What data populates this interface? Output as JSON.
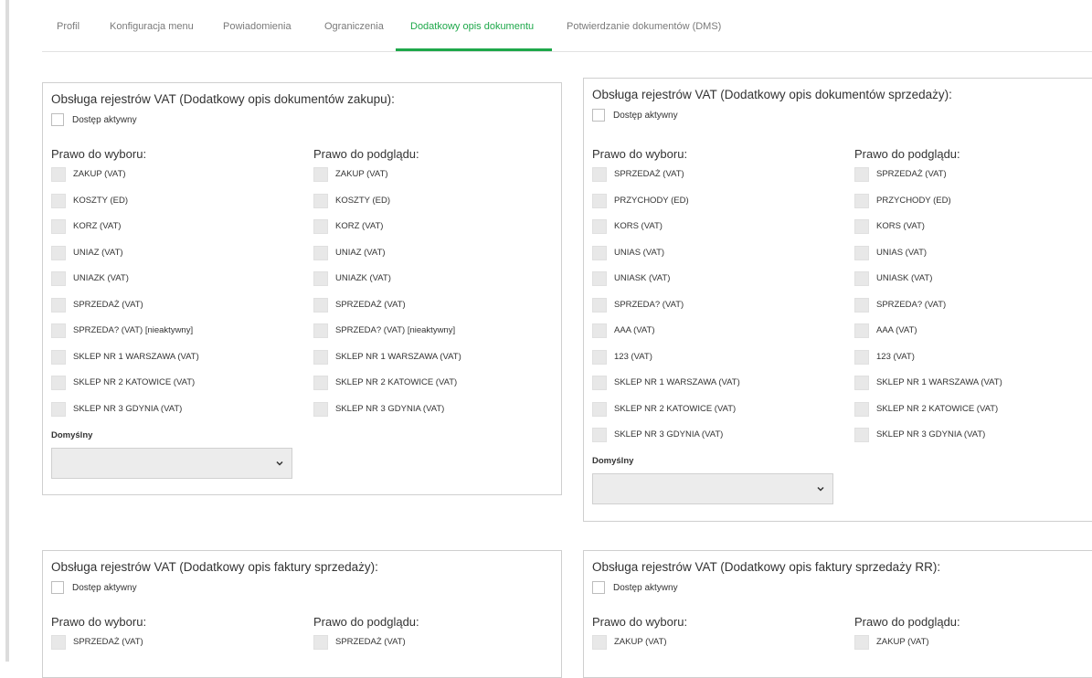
{
  "tabs": [
    {
      "label": "Profil"
    },
    {
      "label": "Konfiguracja menu"
    },
    {
      "label": "Powiadomienia"
    },
    {
      "label": "Ograniczenia"
    },
    {
      "label": "Dodatkowy opis dokumentu"
    },
    {
      "label": "Potwierdzanie dokumentów (DMS)"
    }
  ],
  "active_tab": "Dodatkowy opis dokumentu",
  "colors": {
    "accent": "#1ea84a"
  },
  "labels": {
    "access": "Dostęp aktywny",
    "choose": "Prawo do wyboru:",
    "preview": "Prawo do podglądu:",
    "default": "Domyślny"
  },
  "panels": [
    {
      "title": "Obsługa rejestrów VAT (Dodatkowy opis dokumentów zakupu):",
      "access_checked": false,
      "choose_items": [
        "ZAKUP (VAT)",
        "KOSZTY (ED)",
        "KORZ (VAT)",
        "UNIAZ (VAT)",
        "UNIAZK (VAT)",
        "SPRZEDAŻ (VAT)",
        "SPRZEDA? (VAT) [nieaktywny]",
        "SKLEP NR 1 WARSZAWA (VAT)",
        "SKLEP NR 2 KATOWICE (VAT)",
        "SKLEP NR 3 GDYNIA (VAT)"
      ],
      "preview_items": [
        "ZAKUP (VAT)",
        "KOSZTY (ED)",
        "KORZ (VAT)",
        "UNIAZ (VAT)",
        "UNIAZK (VAT)",
        "SPRZEDAŻ (VAT)",
        "SPRZEDA? (VAT) [nieaktywny]",
        "SKLEP NR 1 WARSZAWA (VAT)",
        "SKLEP NR 2 KATOWICE (VAT)",
        "SKLEP NR 3 GDYNIA (VAT)"
      ],
      "default_value": ""
    },
    {
      "title": "Obsługa rejestrów VAT (Dodatkowy opis dokumentów sprzedaży):",
      "access_checked": false,
      "choose_items": [
        "SPRZEDAŻ (VAT)",
        "PRZYCHODY (ED)",
        "KORS (VAT)",
        "UNIAS (VAT)",
        "UNIASK (VAT)",
        "SPRZEDA? (VAT)",
        "AAA (VAT)",
        "123 (VAT)",
        "SKLEP NR 1 WARSZAWA (VAT)",
        "SKLEP NR 2 KATOWICE (VAT)",
        "SKLEP NR 3 GDYNIA (VAT)"
      ],
      "preview_items": [
        "SPRZEDAŻ (VAT)",
        "PRZYCHODY (ED)",
        "KORS (VAT)",
        "UNIAS (VAT)",
        "UNIASK (VAT)",
        "SPRZEDA? (VAT)",
        "AAA (VAT)",
        "123 (VAT)",
        "SKLEP NR 1 WARSZAWA (VAT)",
        "SKLEP NR 2 KATOWICE (VAT)",
        "SKLEP NR 3 GDYNIA (VAT)"
      ],
      "default_value": ""
    },
    {
      "title": "Obsługa rejestrów VAT (Dodatkowy opis faktury sprzedaży):",
      "access_checked": false,
      "choose_items": [
        "SPRZEDAŻ (VAT)"
      ],
      "preview_items": [
        "SPRZEDAŻ (VAT)"
      ]
    },
    {
      "title": "Obsługa rejestrów VAT (Dodatkowy opis faktury sprzedaży RR):",
      "access_checked": false,
      "choose_items": [
        "ZAKUP (VAT)"
      ],
      "preview_items": [
        "ZAKUP (VAT)"
      ]
    }
  ]
}
